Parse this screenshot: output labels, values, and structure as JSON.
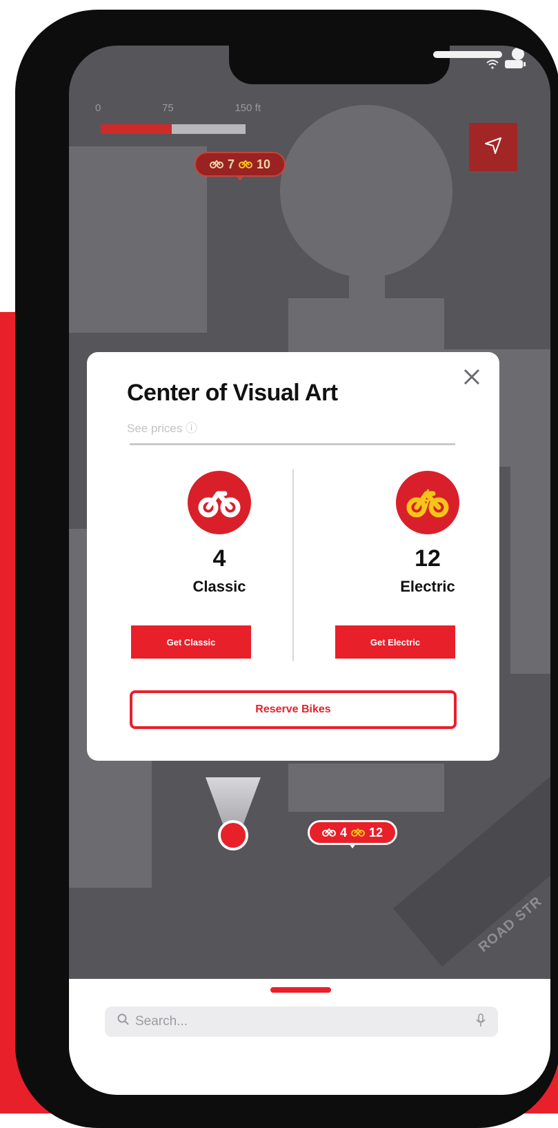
{
  "status_bar": {
    "icons": [
      "wifi-icon",
      "battery-icon"
    ]
  },
  "map": {
    "scale": {
      "labels": [
        "0",
        "75",
        "150 ft"
      ],
      "fill_fraction": 0.49
    },
    "top_pin": {
      "classic": "7",
      "electric": "10"
    },
    "bottom_pin": {
      "classic": "4",
      "electric": "12"
    },
    "road_label": "ROAD STR"
  },
  "station_card": {
    "title": "Center of Visual Art",
    "see_prices": "See prices ⓘ",
    "classic": {
      "count": "4",
      "label": "Classic",
      "button": "Get Classic"
    },
    "electric": {
      "count": "12",
      "label": "Electric",
      "button": "Get Electric"
    },
    "reserve_button": "Reserve Bikes"
  },
  "search": {
    "placeholder": "Search..."
  },
  "colors": {
    "brand_red": "#e8202a",
    "electric_yellow": "#f5c518",
    "map_gray": "#56565a"
  }
}
